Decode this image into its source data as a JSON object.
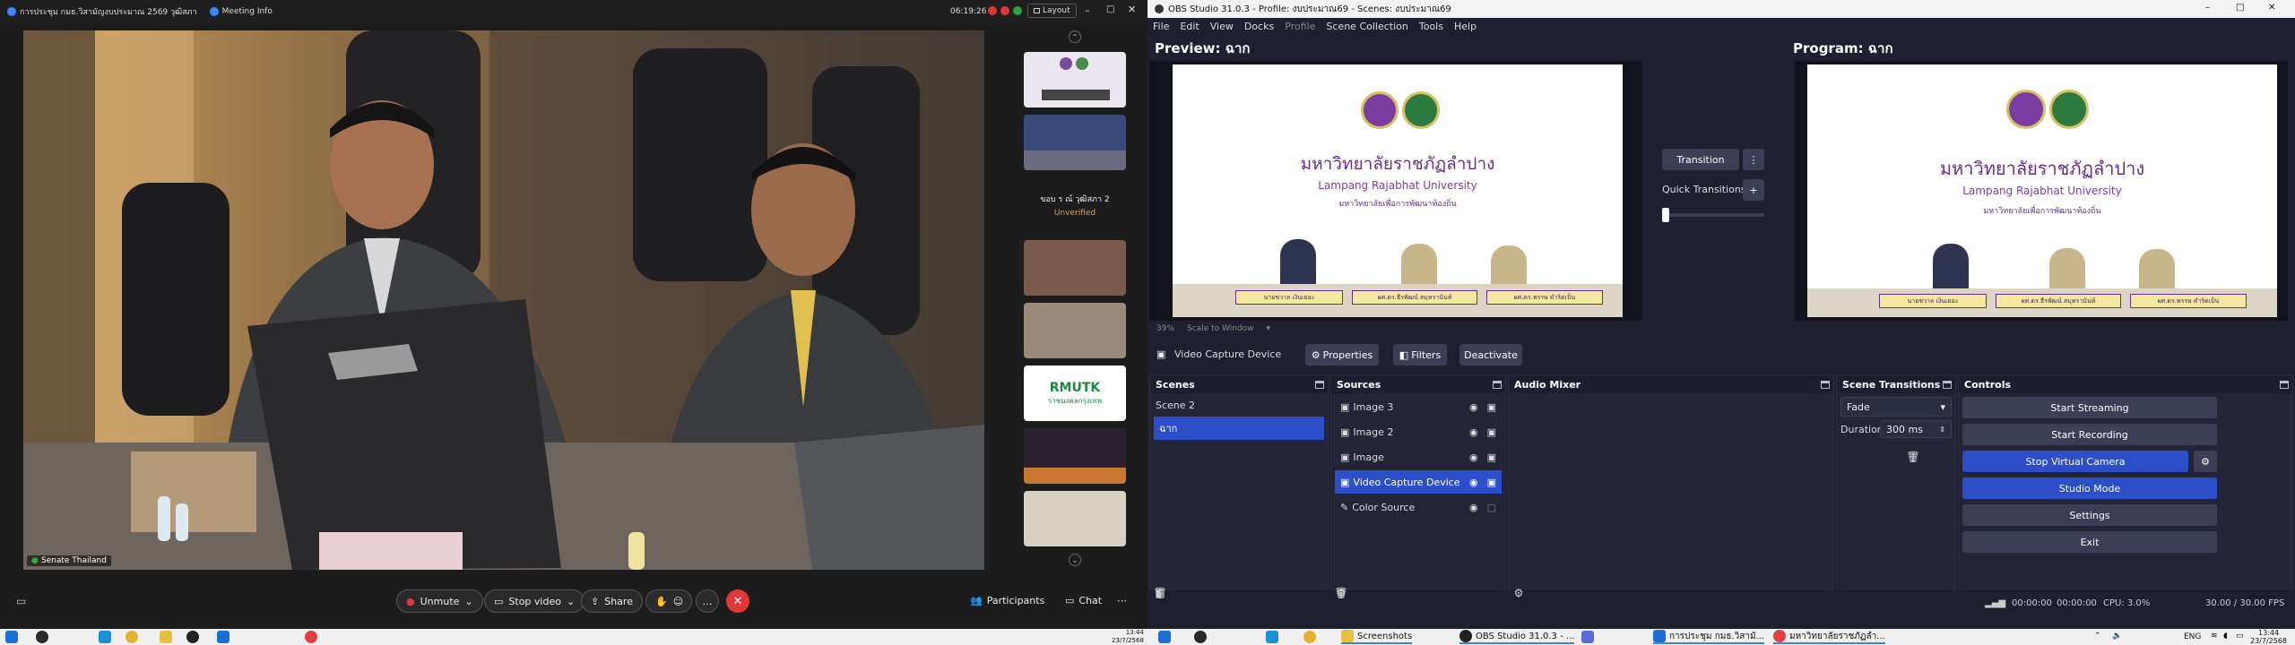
{
  "meeting": {
    "title": "การประชุม กมธ.วิสามัญงบประมาณ 2569 วุฒิสภา",
    "meeting_info": "Meeting Info",
    "timer": "06:19:26",
    "layout_label": "Layout",
    "participant_name": "Senate Thailand",
    "tile_text": "ขอบ ร ณ์ วุฒิสภา 2",
    "tile_status": "Unverified",
    "rmutk_logo": "RMUTK",
    "rmutk_sub": "ราชมงคลกรุงเทพ",
    "unmute": "Unmute",
    "stop_video": "Stop video",
    "share": "Share",
    "participants": "Participants",
    "chat": "Chat"
  },
  "obs": {
    "title": "OBS Studio 31.0.3 - Profile: งบประมาณ69 - Scenes: งบประมาณ69",
    "menu": [
      "File",
      "Edit",
      "View",
      "Docks",
      "Profile",
      "Scene Collection",
      "Tools",
      "Help"
    ],
    "preview_label": "Preview: ฉาก",
    "program_label": "Program: ฉาก",
    "zoom": "39%",
    "scale_mode": "Scale to Window",
    "transition_btn": "Transition",
    "quick_transitions": "Quick Transitions",
    "source_bar": {
      "name": "Video Capture Device",
      "properties": "Properties",
      "filters": "Filters",
      "deactivate": "Deactivate"
    },
    "scenes_title": "Scenes",
    "scenes": [
      "Scene 2",
      "ฉาก"
    ],
    "sources_title": "Sources",
    "sources": [
      "Image 3",
      "Image 2",
      "Image",
      "Video Capture Device",
      "Color Source"
    ],
    "audio_title": "Audio Mixer",
    "transitions_title": "Scene Transitions",
    "transition_type": "Fade",
    "duration_label": "Duration",
    "duration_value": "300 ms",
    "controls_title": "Controls",
    "controls": [
      "Start Streaming",
      "Start Recording",
      "Stop Virtual Camera",
      "Studio Mode",
      "Settings",
      "Exit"
    ],
    "status": {
      "stream_time": "00:00:00",
      "rec_time": "00:00:00",
      "cpu": "CPU: 3.0%",
      "fps": "30.00 / 30.00 FPS"
    }
  },
  "stage": {
    "university_thai": "มหาวิทยาลัยราชภัฏลำปาง",
    "university_en": "Lampang Rajabhat University",
    "tagline": "มหาวิทยาลัยเพื่อการพัฒนาท้องถิ่น",
    "name1": "นายชวาล เงินเยอะ",
    "name2": "ผศ.ดร.ธีรพัฒน์ สมุทรานันท์",
    "name3": "ผศ.ดร.พรรษ ดำริดเป็น"
  },
  "taskbar": {
    "left_time": "13:44",
    "left_date": "23/7/2568",
    "apps": [
      "Screenshots",
      "OBS Studio 31.0.3 - ...",
      "การประชุม กมธ.วิสามั...",
      "มหาวิทยาลัยราชภัฏลำ..."
    ],
    "lang": "ENG",
    "time": "13:44",
    "date": "23/7/2568"
  }
}
